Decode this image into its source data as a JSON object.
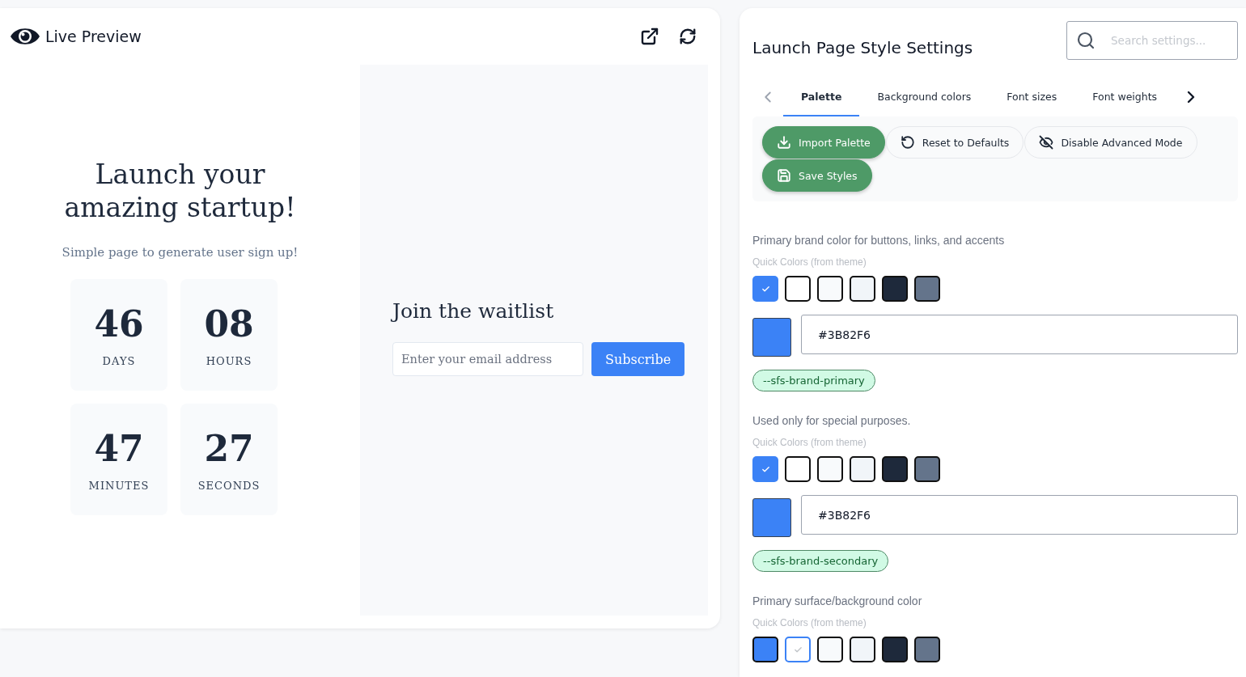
{
  "preview": {
    "title": "Live Preview",
    "page": {
      "headline": "Launch your amazing startup!",
      "subtitle": "Simple page to generate user sign up!",
      "countdown": [
        {
          "value": "46",
          "label": "DAYS"
        },
        {
          "value": "08",
          "label": "HOURS"
        },
        {
          "value": "47",
          "label": "MINUTES"
        },
        {
          "value": "27",
          "label": "SECONDS"
        }
      ],
      "waitlist": {
        "title": "Join the waitlist",
        "placeholder": "Enter your email address",
        "button": "Subscribe"
      }
    }
  },
  "settings": {
    "title": "Launch Page Style Settings",
    "search": {
      "placeholder": "Search settings..."
    },
    "tabs": [
      {
        "label": "Palette",
        "selected": true
      },
      {
        "label": "Background colors",
        "selected": false
      },
      {
        "label": "Font sizes",
        "selected": false
      },
      {
        "label": "Font weights",
        "selected": false
      }
    ],
    "actions": [
      {
        "label": "Import Palette",
        "kind": "primary"
      },
      {
        "label": "Reset to Defaults",
        "kind": "outline"
      },
      {
        "label": "Disable Advanced Mode",
        "kind": "outline"
      },
      {
        "label": "Save Styles",
        "kind": "primary"
      }
    ],
    "sections": [
      {
        "description": "Primary brand color for buttons, links, and accents",
        "quick_colors_label": "Quick Colors (from theme)",
        "swatches": [
          {
            "color": "#3b82f6",
            "selected": true
          },
          {
            "color": "#ffffff",
            "selected": false
          },
          {
            "color": "#f8fafc",
            "selected": false
          },
          {
            "color": "#f1f5f9",
            "selected": false
          },
          {
            "color": "#1e293b",
            "selected": false
          },
          {
            "color": "#64748b",
            "selected": false
          }
        ],
        "value": "#3B82F6",
        "variable": "--sfs-brand-primary"
      },
      {
        "description": "Used only for special purposes.",
        "quick_colors_label": "Quick Colors (from theme)",
        "swatches": [
          {
            "color": "#3b82f6",
            "selected": true
          },
          {
            "color": "#ffffff",
            "selected": false
          },
          {
            "color": "#f8fafc",
            "selected": false
          },
          {
            "color": "#f1f5f9",
            "selected": false
          },
          {
            "color": "#1e293b",
            "selected": false
          },
          {
            "color": "#64748b",
            "selected": false
          }
        ],
        "value": "#3B82F6",
        "variable": "--sfs-brand-secondary"
      },
      {
        "description": "Primary surface/background color",
        "quick_colors_label": "Quick Colors (from theme)",
        "swatches": [
          {
            "color": "#3b82f6",
            "selected": false
          },
          {
            "color": "#ffffff",
            "selected": true
          },
          {
            "color": "#f8fafc",
            "selected": false
          },
          {
            "color": "#f1f5f9",
            "selected": false
          },
          {
            "color": "#1e293b",
            "selected": false
          },
          {
            "color": "#64748b",
            "selected": false
          }
        ]
      }
    ]
  }
}
